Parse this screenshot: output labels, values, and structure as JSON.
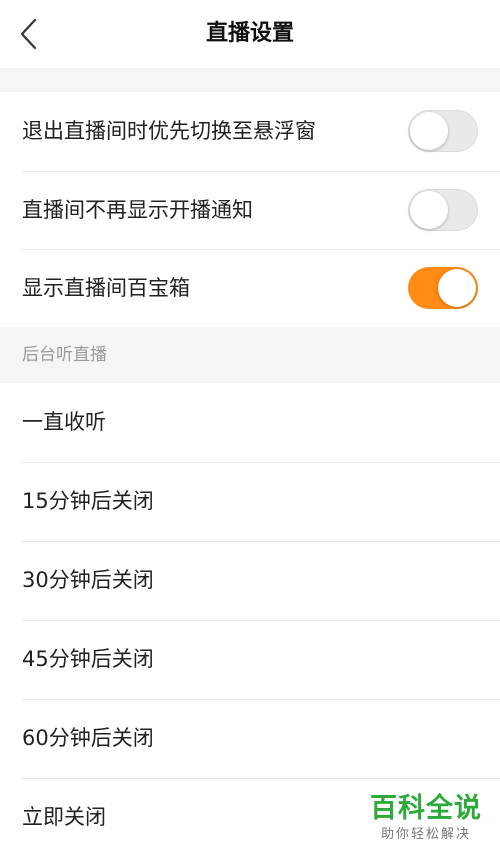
{
  "header": {
    "title": "直播设置",
    "back_icon": "chevron-left-icon"
  },
  "settings": [
    {
      "label": "退出直播间时优先切换至悬浮窗",
      "enabled": false
    },
    {
      "label": "直播间不再显示开播通知",
      "enabled": false
    },
    {
      "label": "显示直播间百宝箱",
      "enabled": true
    }
  ],
  "background_listen": {
    "section_label": "后台听直播",
    "options": [
      {
        "label": "一直收听"
      },
      {
        "label": "15分钟后关闭"
      },
      {
        "label": "30分钟后关闭"
      },
      {
        "label": "45分钟后关闭"
      },
      {
        "label": "60分钟后关闭"
      },
      {
        "label": "立即关闭"
      }
    ]
  },
  "watermark": {
    "title": "百科全说",
    "subtitle": "助你轻松解决"
  },
  "colors": {
    "toggle_on": "#ff8a14",
    "toggle_off": "#e9e9eb",
    "section_background": "#f5f5f7",
    "watermark_green": "#2eaa3a"
  }
}
